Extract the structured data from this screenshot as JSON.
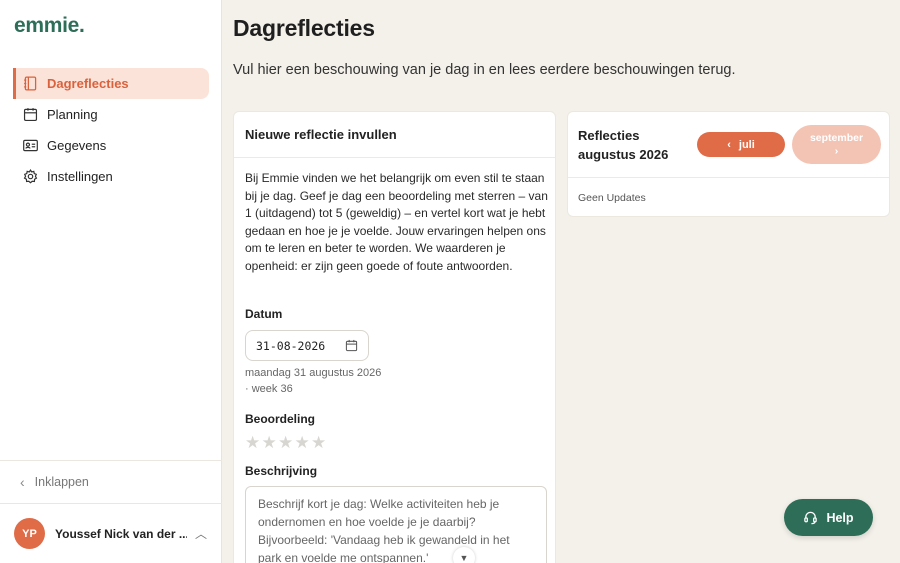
{
  "app": {
    "logo": "emmie",
    "logo_dot": "."
  },
  "sidebar": {
    "items": [
      {
        "label": "Dagreflecties",
        "icon": "notebook-icon",
        "active": true
      },
      {
        "label": "Planning",
        "icon": "calendar-icon",
        "active": false
      },
      {
        "label": "Gegevens",
        "icon": "id-card-icon",
        "active": false
      },
      {
        "label": "Instellingen",
        "icon": "gear-icon",
        "active": false
      }
    ],
    "collapse_label": "Inklappen",
    "user": {
      "initials": "YP",
      "name": "Youssef Nick van der ..."
    }
  },
  "page": {
    "title": "Dagreflecties",
    "subtitle": "Vul hier een beschouwing van je dag in en lees eerdere beschouwingen terug."
  },
  "new_reflection": {
    "heading": "Nieuwe reflectie invullen",
    "intro": "Bij Emmie vinden we het belangrijk om even stil te staan bij je dag. Geef je dag een beoordeling met sterren – van 1 (uitdagend) tot 5 (geweldig) – en vertel kort wat je hebt gedaan en hoe je je voelde. Jouw ervaringen helpen ons om te leren en beter te worden. We waarderen je openheid: er zijn geen goede of foute antwoorden.",
    "date_label": "Datum",
    "date_value": "31-08-2026",
    "date_hint": "maandag 31 augustus 2026 · week 36",
    "rating_label": "Beoordeling",
    "rating": 0,
    "rating_max": 5,
    "description_label": "Beschrijving",
    "description_placeholder": "Beschrijf kort je dag: Welke activiteiten heb je ondernomen en hoe voelde je je daarbij? Bijvoorbeeld: 'Vandaag heb ik gewandeld in het park en voelde me ontspannen.'"
  },
  "reflections": {
    "title": "Reflecties augustus 2026",
    "prev_label": "juli",
    "next_label": "september",
    "empty_text": "Geen Updates"
  },
  "help": {
    "label": "Help"
  },
  "colors": {
    "accent": "#e06b47",
    "brand": "#2e6e58",
    "background": "#f4f1ea"
  }
}
